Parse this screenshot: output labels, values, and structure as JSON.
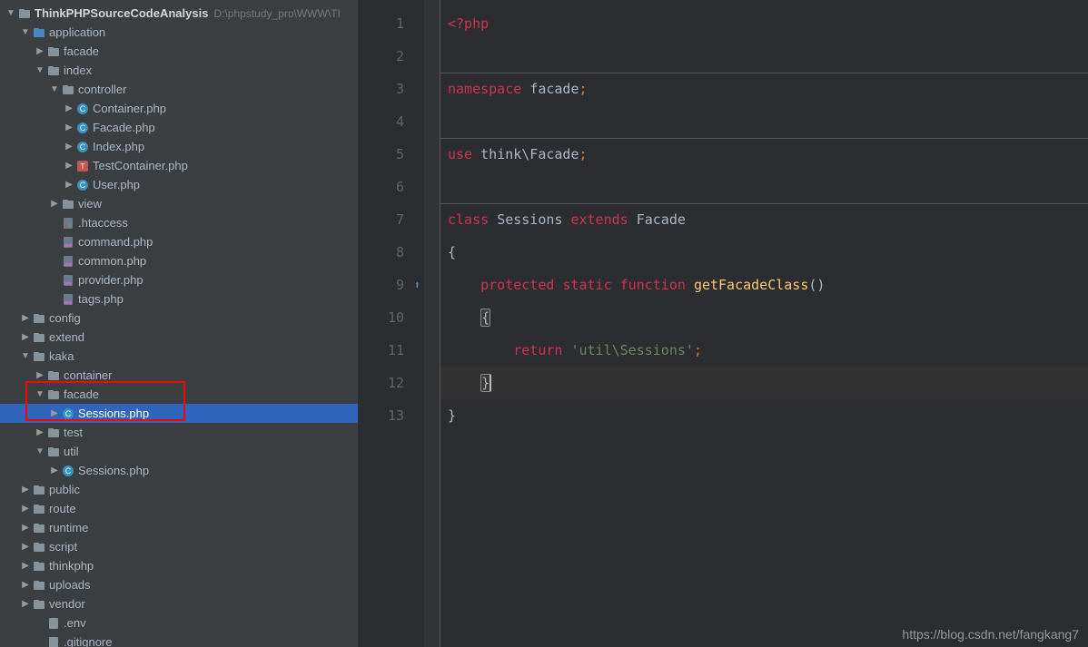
{
  "project": {
    "root": "ThinkPHPSourceCodeAnalysis",
    "root_path": "D:\\phpstudy_pro\\WWW\\TI"
  },
  "tree": [
    {
      "indent": 0,
      "arrow": "down",
      "icon": "folder-root",
      "label": "ThinkPHPSourceCodeAnalysis",
      "bold": true,
      "hint": "D:\\phpstudy_pro\\WWW\\TI"
    },
    {
      "indent": 1,
      "arrow": "down",
      "icon": "folder-blue",
      "label": "application"
    },
    {
      "indent": 2,
      "arrow": "right",
      "icon": "folder",
      "label": "facade"
    },
    {
      "indent": 2,
      "arrow": "down",
      "icon": "folder",
      "label": "index"
    },
    {
      "indent": 3,
      "arrow": "down",
      "icon": "folder",
      "label": "controller"
    },
    {
      "indent": 4,
      "arrow": "right",
      "icon": "php-class",
      "label": "Container.php"
    },
    {
      "indent": 4,
      "arrow": "right",
      "icon": "php-class",
      "label": "Facade.php"
    },
    {
      "indent": 4,
      "arrow": "right",
      "icon": "php-class",
      "label": "Index.php"
    },
    {
      "indent": 4,
      "arrow": "right",
      "icon": "php-test",
      "label": "TestContainer.php"
    },
    {
      "indent": 4,
      "arrow": "right",
      "icon": "php-class",
      "label": "User.php"
    },
    {
      "indent": 3,
      "arrow": "right",
      "icon": "folder",
      "label": "view"
    },
    {
      "indent": 3,
      "arrow": "none",
      "icon": "htaccess",
      "label": ".htaccess"
    },
    {
      "indent": 3,
      "arrow": "none",
      "icon": "php-file",
      "label": "command.php"
    },
    {
      "indent": 3,
      "arrow": "none",
      "icon": "php-file",
      "label": "common.php"
    },
    {
      "indent": 3,
      "arrow": "none",
      "icon": "php-file",
      "label": "provider.php"
    },
    {
      "indent": 3,
      "arrow": "none",
      "icon": "php-file",
      "label": "tags.php"
    },
    {
      "indent": 1,
      "arrow": "right",
      "icon": "folder",
      "label": "config"
    },
    {
      "indent": 1,
      "arrow": "right",
      "icon": "folder",
      "label": "extend"
    },
    {
      "indent": 1,
      "arrow": "down",
      "icon": "folder",
      "label": "kaka"
    },
    {
      "indent": 2,
      "arrow": "right",
      "icon": "folder",
      "label": "container"
    },
    {
      "indent": 2,
      "arrow": "down",
      "icon": "folder",
      "label": "facade",
      "boxed": true
    },
    {
      "indent": 3,
      "arrow": "right",
      "icon": "php-class",
      "label": "Sessions.php",
      "selected": true,
      "boxed": true
    },
    {
      "indent": 2,
      "arrow": "right",
      "icon": "folder",
      "label": "test"
    },
    {
      "indent": 2,
      "arrow": "down",
      "icon": "folder",
      "label": "util"
    },
    {
      "indent": 3,
      "arrow": "right",
      "icon": "php-class",
      "label": "Sessions.php"
    },
    {
      "indent": 1,
      "arrow": "right",
      "icon": "folder",
      "label": "public"
    },
    {
      "indent": 1,
      "arrow": "right",
      "icon": "folder",
      "label": "route"
    },
    {
      "indent": 1,
      "arrow": "right",
      "icon": "folder",
      "label": "runtime"
    },
    {
      "indent": 1,
      "arrow": "right",
      "icon": "folder",
      "label": "script"
    },
    {
      "indent": 1,
      "arrow": "right",
      "icon": "folder",
      "label": "thinkphp"
    },
    {
      "indent": 1,
      "arrow": "right",
      "icon": "folder",
      "label": "uploads"
    },
    {
      "indent": 1,
      "arrow": "right",
      "icon": "folder",
      "label": "vendor"
    },
    {
      "indent": 2,
      "arrow": "none",
      "icon": "file",
      "label": ".env"
    },
    {
      "indent": 2,
      "arrow": "none",
      "icon": "file",
      "label": ".gitignore"
    }
  ],
  "code": {
    "lines": [
      {
        "n": 1,
        "tokens": [
          {
            "t": "<?php",
            "c": "k-red"
          }
        ]
      },
      {
        "n": 2,
        "tokens": []
      },
      {
        "n": 3,
        "tokens": [
          {
            "t": "namespace ",
            "c": "k-red"
          },
          {
            "t": "facade",
            "c": "plain"
          },
          {
            "t": ";",
            "c": "k-orange"
          }
        ]
      },
      {
        "n": 4,
        "tokens": []
      },
      {
        "n": 5,
        "tokens": [
          {
            "t": "use ",
            "c": "k-red"
          },
          {
            "t": "think\\Facade",
            "c": "plain"
          },
          {
            "t": ";",
            "c": "k-orange"
          }
        ]
      },
      {
        "n": 6,
        "tokens": []
      },
      {
        "n": 7,
        "fold": "open",
        "tokens": [
          {
            "t": "class ",
            "c": "k-red"
          },
          {
            "t": "Sessions ",
            "c": "plain"
          },
          {
            "t": "extends ",
            "c": "k-red"
          },
          {
            "t": "Facade",
            "c": "plain"
          }
        ]
      },
      {
        "n": 8,
        "tokens": [
          {
            "t": "{",
            "c": "plain"
          }
        ]
      },
      {
        "n": 9,
        "override": true,
        "fold": "open",
        "tokens": [
          {
            "t": "    ",
            "c": "plain"
          },
          {
            "t": "protected ",
            "c": "k-red"
          },
          {
            "t": "static ",
            "c": "k-red"
          },
          {
            "t": "function ",
            "c": "k-red"
          },
          {
            "t": "getFacadeClass",
            "c": "k-yellow"
          },
          {
            "t": "()",
            "c": "plain"
          }
        ]
      },
      {
        "n": 10,
        "tokens": [
          {
            "t": "    ",
            "c": "plain"
          },
          {
            "t": "{",
            "c": "plain",
            "hl": true
          }
        ]
      },
      {
        "n": 11,
        "tokens": [
          {
            "t": "        ",
            "c": "plain"
          },
          {
            "t": "return ",
            "c": "k-red"
          },
          {
            "t": "'util\\Sessions'",
            "c": "k-green"
          },
          {
            "t": ";",
            "c": "k-orange"
          }
        ]
      },
      {
        "n": 12,
        "fold": "close",
        "current": true,
        "tokens": [
          {
            "t": "    ",
            "c": "plain"
          },
          {
            "t": "}",
            "c": "plain",
            "hl": true,
            "caret": true
          }
        ]
      },
      {
        "n": 13,
        "fold": "close",
        "tokens": [
          {
            "t": "}",
            "c": "plain"
          }
        ]
      }
    ],
    "hrules": [
      2,
      4,
      6
    ]
  },
  "watermark": "https://blog.csdn.net/fangkang7"
}
